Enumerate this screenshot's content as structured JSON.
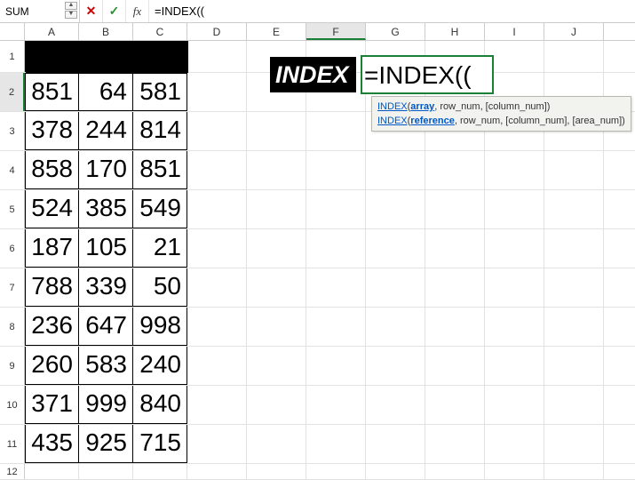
{
  "formula_bar": {
    "name_box": "SUM",
    "cancel_glyph": "✕",
    "accept_glyph": "✓",
    "fx_label": "fx",
    "formula_text": "=INDEX(("
  },
  "columns": [
    "A",
    "B",
    "C",
    "D",
    "E",
    "F",
    "G",
    "H",
    "I",
    "J"
  ],
  "active_column_index": 5,
  "active_row": 2,
  "row_numbers": [
    1,
    2,
    3,
    4,
    5,
    6,
    7,
    8,
    9,
    10,
    11,
    12
  ],
  "grid_data": [
    [
      851,
      64,
      581
    ],
    [
      378,
      244,
      814
    ],
    [
      858,
      170,
      851
    ],
    [
      524,
      385,
      549
    ],
    [
      187,
      105,
      21
    ],
    [
      788,
      339,
      50
    ],
    [
      236,
      647,
      998
    ],
    [
      260,
      583,
      240
    ],
    [
      371,
      999,
      840
    ],
    [
      435,
      925,
      715
    ]
  ],
  "label_cell": "INDEX",
  "edit_cell_text": "=INDEX((",
  "tooltip": {
    "fn": "INDEX",
    "sig1_arg1": "array",
    "sig1_rest": ", row_num, [column_num])",
    "sig2_arg1": "reference",
    "sig2_rest": ", row_num, [column_num], [area_num])"
  },
  "col_widths": {
    "data": 61,
    "std": 67
  }
}
